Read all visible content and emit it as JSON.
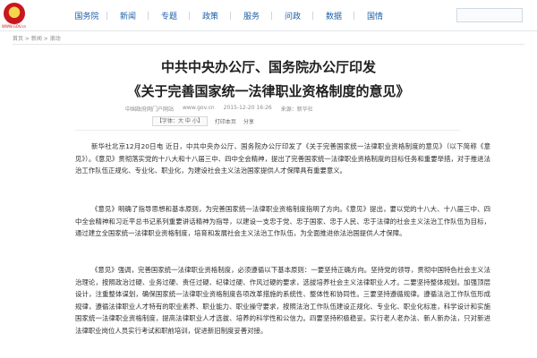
{
  "site": {
    "emblem_caption": "WWW.GOV.cn",
    "nav": [
      "国务院",
      "新闻",
      "专题",
      "政策",
      "服务",
      "问政",
      "数据",
      "国情"
    ]
  },
  "breadcrumb": "首页 > 新闻 > 滚动",
  "article": {
    "title_line1": "中共中央办公厅、国务院办公厅印发",
    "title_line2": "《关于完善国家统一法律职业资格制度的意见》",
    "source": "中国政府网门户网站",
    "source_url": "www.gov.cn",
    "datetime": "2015-12-20 16:26",
    "origin": "来源：新华社",
    "font_label": "【字体：大 中 小】",
    "print_label": "打印本页",
    "share_label": "分享",
    "paragraphs": [
      "新华社北京12月20日电 近日，中共中央办公厅、国务院办公厅印发了《关于完善国家统一法律职业资格制度的意见》（以下简称《意见》）。《意见》贯彻落实党的十八大和十八届三中、四中全会精神，提出了完善国家统一法律职业资格制度的目标任务和重要举措，对于推进法治工作队伍正规化、专业化、职业化，为建设社会主义法治国家提供人才保障具有重要意义。",
      "《意见》明确了指导思想和基本原则，为完善国家统一法律职业资格制度指明了方向。《意见》提出，要以党的十八大、十八届三中、四中全会精神和习近平总书记系列重要讲话精神为指导，以建设一支忠于党、忠于国家、忠于人民、忠于法律的社会主义法治工作队伍为目标，通过建立全国家统一法律职业资格制度，培育和发展社会主义法治工作队伍，为全面推进依法治国提供人才保障。",
      "《意见》强调，完善国家统一法律职业资格制度，必须遵循以下基本原则：一要坚持正确方向。坚持党的领导，贯彻中国特色社会主义法治理论，按照政治过硬、业务过硬、责任过硬、纪律过硬、作风过硬的要求，选拔培养社会主义法律职业人才。二要坚持整体规划。加强顶层设计，注重整体谋划，确保国家统一法律职业资格制度各项改革措施的系统性、整体性和协同性。三要坚持遵循规律。遵循法治工作队伍形成规律，遵循法律职业人才特有的职业素养、职业能力、职业操守要求，按照法治工作队伍建设正规化、专业化、职业化标准，科学设计和实施国家统一法律职业资格制度，提高法律职业人才选拔、培养的科学性和公信力。四要坚持积极稳妥。实行老人老办法、新人新办法，只对新进法律职业岗位人员实行考试和职前培训，促进新旧制度妥善对接。"
    ]
  }
}
